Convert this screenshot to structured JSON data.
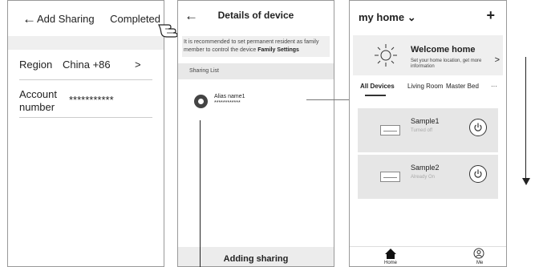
{
  "add_sharing": {
    "title": "Add Sharing",
    "completed_label": "Completed",
    "region_label": "Region",
    "region_value": "China +86",
    "region_chevron": ">",
    "account_label_line1": "Account",
    "account_label_line2": "number",
    "account_value": "***********"
  },
  "details": {
    "title": "Details of device",
    "note_text": "It is recommended to set permanent resident as family member to control the device ",
    "note_link": "Family Settings",
    "sharing_list_label": "Sharing List",
    "alias_name": "Alias name1",
    "alias_value": "************",
    "bottom_button": "Adding sharing"
  },
  "home": {
    "home_title": "my home",
    "home_chevron": "⌄",
    "add_label": "+",
    "welcome_title": "Welcome home",
    "welcome_sub": "Set your home location, get more information",
    "welcome_chevron": ">",
    "tabs": [
      "All Devices",
      "Living Room",
      "Master Bed"
    ],
    "more_label": "···",
    "devices": [
      {
        "name": "Sample1",
        "status": "Turned off"
      },
      {
        "name": "Sample2",
        "status": "Already On"
      }
    ],
    "nav_home": "Home",
    "nav_me": "Me"
  }
}
